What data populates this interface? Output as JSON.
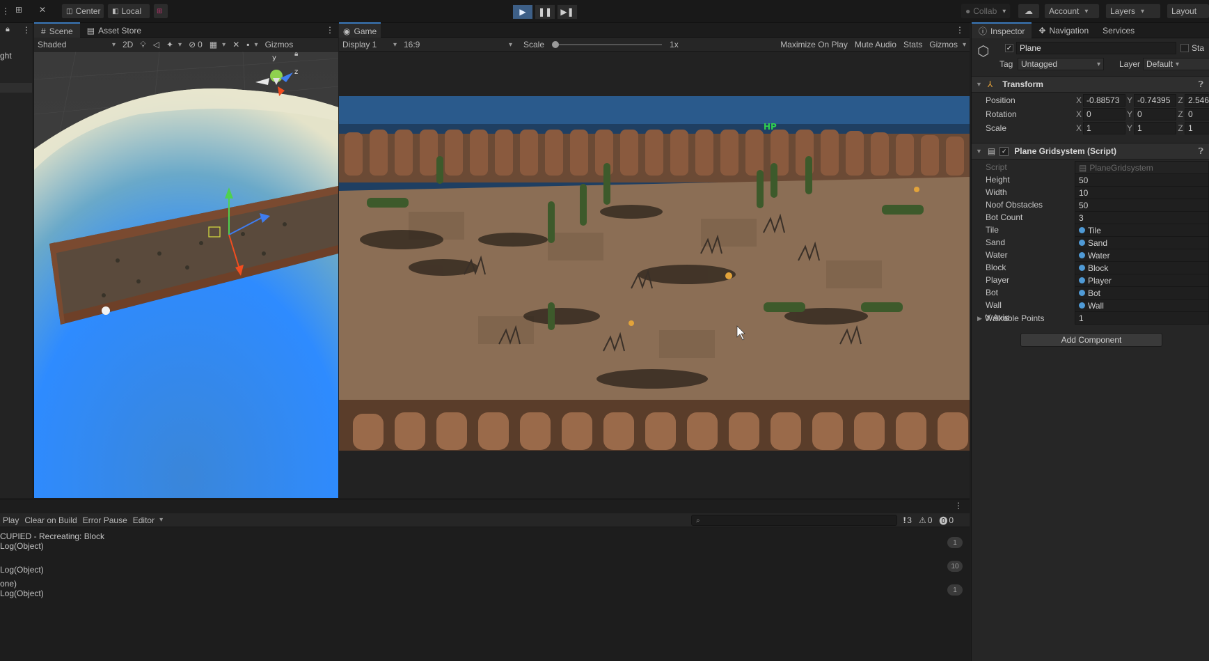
{
  "toolbar": {
    "pivot": "Center",
    "space": "Local",
    "collab": "Collab",
    "account": "Account",
    "layers": "Layers",
    "layout": "Layout"
  },
  "scene_panel": {
    "tabs": [
      "Scene",
      "Asset Store"
    ],
    "shading_mode": "Shaded",
    "mode_2d": "2D",
    "hidden_count": "0",
    "gizmos": "Gizmos",
    "hierarchy_fragment": "ght"
  },
  "game_panel": {
    "tab": "Game",
    "display": "Display 1",
    "aspect": "16:9",
    "scale_label": "Scale",
    "scale_value": "1x",
    "scale_level": 0.0,
    "maximize": "Maximize On Play",
    "mute": "Mute Audio",
    "stats": "Stats",
    "gizmos": "Gizmos",
    "overlay_hp": "HP"
  },
  "inspector": {
    "tabs": [
      "Inspector",
      "Navigation",
      "Services"
    ],
    "object_name": "Plane",
    "static_label": "Sta",
    "tag_label": "Tag",
    "tag_value": "Untagged",
    "layer_label": "Layer",
    "layer_value": "Default",
    "transform": {
      "title": "Transform",
      "position": {
        "label": "Position",
        "x": "-0.88573",
        "y": "-0.74395",
        "z": "2.546"
      },
      "rotation": {
        "label": "Rotation",
        "x": "0",
        "y": "0",
        "z": "0"
      },
      "scale": {
        "label": "Scale",
        "x": "1",
        "y": "1",
        "z": "1"
      }
    },
    "script_component": {
      "title": "Plane Gridsystem (Script)",
      "script_label": "Script",
      "script_value": "PlaneGridsystem",
      "fields": [
        {
          "label": "Height",
          "value": "50",
          "is_object": false
        },
        {
          "label": "Width",
          "value": "10",
          "is_object": false
        },
        {
          "label": "Noof Obstacles",
          "value": "50",
          "is_object": false
        },
        {
          "label": "Bot Count",
          "value": "3",
          "is_object": false
        },
        {
          "label": "Tile",
          "value": "Tile",
          "is_object": true
        },
        {
          "label": "Sand",
          "value": "Sand",
          "is_object": true
        },
        {
          "label": "Water",
          "value": "Water",
          "is_object": true
        },
        {
          "label": "Block",
          "value": "Block",
          "is_object": true
        },
        {
          "label": "Player",
          "value": "Player",
          "is_object": true
        },
        {
          "label": "Bot",
          "value": "Bot",
          "is_object": true
        },
        {
          "label": "Wall",
          "value": "Wall",
          "is_object": true
        },
        {
          "label": "Y Axis",
          "value": "1",
          "is_object": false
        }
      ],
      "walkable": "Walkable Points"
    },
    "add_component": "Add Component"
  },
  "console": {
    "toggles": [
      "Play",
      "Clear on Build",
      "Error Pause",
      "Editor"
    ],
    "counts": {
      "info": "3",
      "warn": "0",
      "error": "0"
    },
    "lines": [
      {
        "text": "CUPIED - Recreating: Block",
        "sub": "Log(Object)",
        "count": "1"
      },
      {
        "text": "",
        "sub": "Log(Object)",
        "count": "10"
      },
      {
        "text": "one)",
        "sub": "Log(Object)",
        "count": "1"
      }
    ]
  }
}
